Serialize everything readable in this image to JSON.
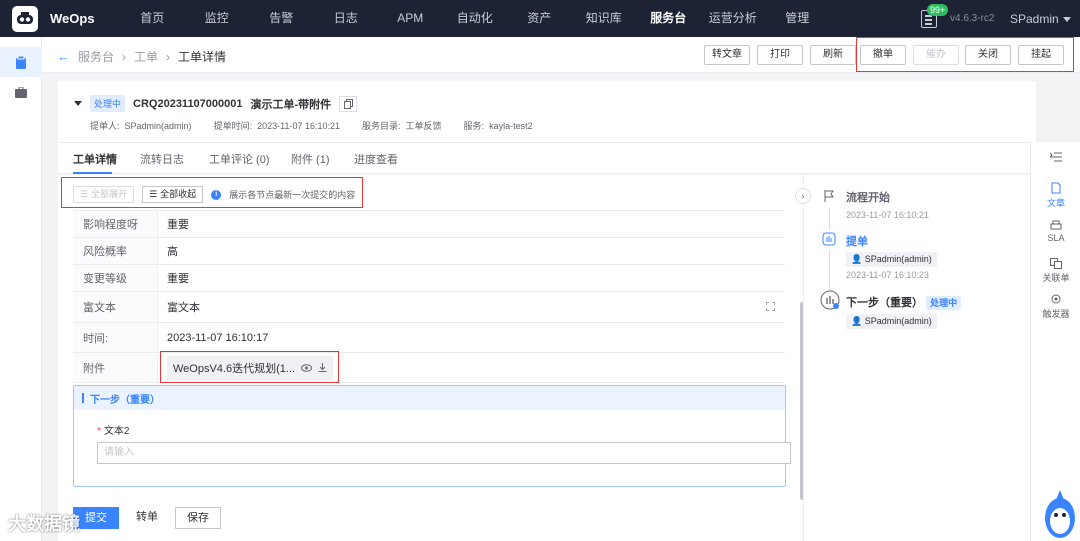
{
  "topnav": {
    "brand": "WeOps",
    "items": [
      "首页",
      "监控",
      "告警",
      "日志",
      "APM",
      "自动化",
      "资产",
      "知识库",
      "服务台",
      "运营分析",
      "管理"
    ],
    "active_index": 8,
    "badge": "99+",
    "version": "v4.6.3-rc2",
    "user": "SPadmin"
  },
  "breadcrumb": {
    "items": [
      "服务台",
      "工单",
      "工单详情"
    ]
  },
  "header_buttons": {
    "transfer_article": "转文章",
    "print": "打印",
    "refresh": "刷新",
    "withdraw": "撤单",
    "urge": "催办",
    "close": "关闭",
    "suspend": "挂起"
  },
  "ticket": {
    "status": "处理中",
    "number": "CRQ20231107000001",
    "title": "演示工单-带附件",
    "submitter_label": "提单人:",
    "submitter": "SPadmin(admin)",
    "submit_time_label": "提单时间:",
    "submit_time": "2023-11-07 16:10:21",
    "catalog_label": "服务目录:",
    "catalog": "工单反馈",
    "service_label": "服务:",
    "service": "kayla-test2"
  },
  "tabs": [
    "工单详情",
    "流转日志",
    "工单评论 (0)",
    "附件 (1)",
    "进度查看"
  ],
  "tools": {
    "expand_all": "全部展开",
    "collapse_all": "全部收起",
    "hint": "展示各节点最新一次提交的内容"
  },
  "fields": [
    {
      "key": "影响程度呀",
      "value": "重要"
    },
    {
      "key": "风险概率",
      "value": "高"
    },
    {
      "key": "变更等级",
      "value": "重要"
    },
    {
      "key": "富文本",
      "value": "富文本"
    },
    {
      "key": "时间:",
      "value": "2023-11-07 16:10:17"
    }
  ],
  "attachment": {
    "key": "附件",
    "filename": "WeOpsV4.6迭代规划(1..."
  },
  "next_step": {
    "title": "下一步（重要）",
    "field_label": "文本2",
    "placeholder": "请输入"
  },
  "bottom_buttons": {
    "submit": "提交",
    "transfer": "转单",
    "save": "保存"
  },
  "flow": [
    {
      "title": "流程开始",
      "time": "2023-11-07 16:10:21"
    },
    {
      "title": "提单",
      "user": "SPadmin(admin)",
      "time": "2023-11-07 16:10:23"
    },
    {
      "title": "下一步（重要）",
      "status": "处理中",
      "user": "SPadmin(admin)"
    }
  ],
  "rightbar": [
    "文章",
    "SLA",
    "关联单",
    "触发器"
  ],
  "watermark": "大数据镜"
}
